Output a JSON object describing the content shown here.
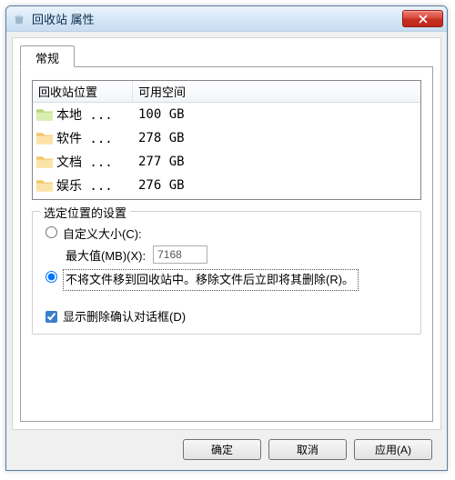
{
  "window": {
    "title": "回收站 属性"
  },
  "tab": {
    "label": "常规"
  },
  "listview": {
    "headers": {
      "location": "回收站位置",
      "space": "可用空间"
    },
    "rows": [
      {
        "name": "本地 ...",
        "space": "100 GB"
      },
      {
        "name": "软件 ...",
        "space": "278 GB"
      },
      {
        "name": "文档 ...",
        "space": "277 GB"
      },
      {
        "name": "娱乐 ...",
        "space": "276 GB"
      }
    ]
  },
  "group": {
    "legend": "选定位置的设置",
    "custom_size_label": "自定义大小(C):",
    "max_label": "最大值(MB)(X):",
    "max_value": "7168",
    "nomove_label": "不将文件移到回收站中。移除文件后立即将其删除(R)。",
    "confirm_label": "显示删除确认对话框(D)"
  },
  "buttons": {
    "ok": "确定",
    "cancel": "取消",
    "apply": "应用(A)"
  }
}
